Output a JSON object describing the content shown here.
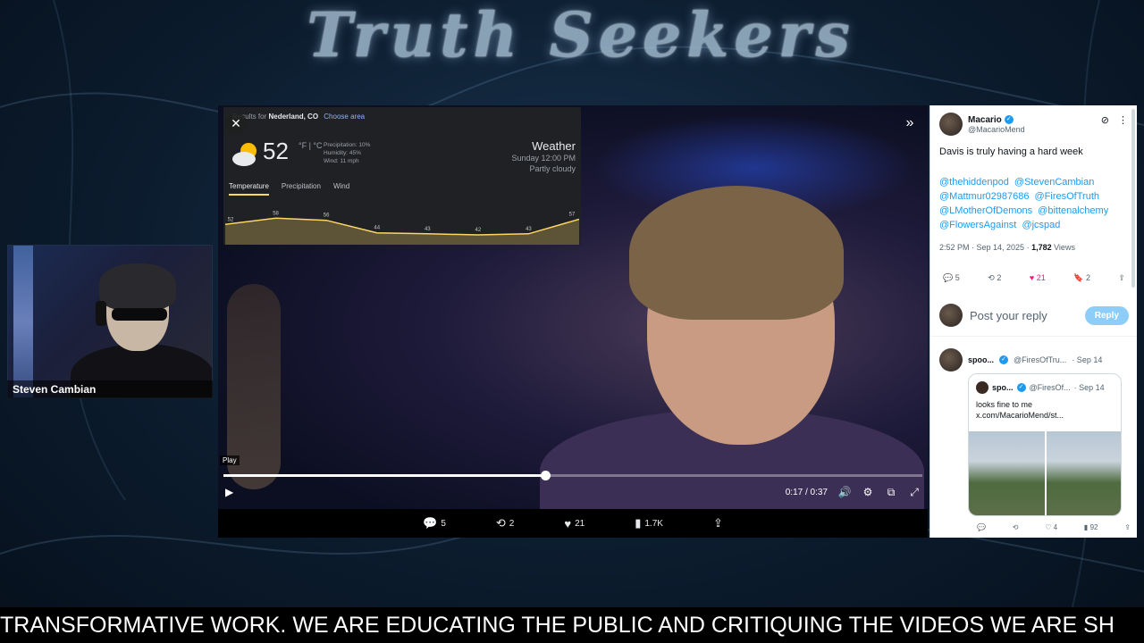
{
  "brand": {
    "title": "Truth Seekers"
  },
  "webcam": {
    "name": "Steven Cambian"
  },
  "weather": {
    "results_prefix": "Results for",
    "location": "Nederland, CO",
    "choose_area": "Choose area",
    "temp": "52",
    "units": "°F | °C",
    "precipitation": "Precipitation: 10%",
    "humidity": "Humidity: 45%",
    "wind": "Wind: 11 mph",
    "title": "Weather",
    "time": "Sunday 12:00 PM",
    "condition": "Partly cloudy",
    "tabs": [
      "Temperature",
      "Precipitation",
      "Wind"
    ],
    "graph_values": [
      52,
      58,
      56,
      44,
      43,
      42,
      43,
      57
    ]
  },
  "player": {
    "play_tooltip": "Play",
    "time": "0:17 / 0:37",
    "progress_fraction": 0.46
  },
  "video_actions": {
    "replies": "5",
    "reposts": "2",
    "likes": "21",
    "views": "1.7K"
  },
  "tweet": {
    "name": "Macario",
    "handle": "@MacarioMend",
    "text": "Davis is truly having a hard week",
    "mentions": [
      "@thehiddenpod",
      "@StevenCambian",
      "@Mattmur02987686",
      "@FiresOfTruth",
      "@LMotherOfDemons",
      "@bittenalchemy",
      "@FlowersAgainst",
      "@jcspad"
    ],
    "time": "2:52 PM · Sep 14, 2025 · ",
    "views_count": "1,782",
    "views_label": " Views",
    "replies": "5",
    "reposts": "2",
    "likes": "21",
    "bookmarks": "2",
    "reply_placeholder": "Post your reply",
    "reply_button": "Reply"
  },
  "reply": {
    "name": "spoo...",
    "handle": "@FiresOfTru...",
    "date": "· Sep 14",
    "quote": {
      "name": "spo...",
      "handle": "@FiresOf...",
      "date": "· Sep 14",
      "text1": "looks fine to me",
      "text2": "x.com/MacarioMend/st..."
    },
    "replies": "",
    "reposts": "",
    "likes": "4",
    "views": "92"
  },
  "ticker": {
    "text": "TRANSFORMATIVE WORK. WE ARE EDUCATING THE PUBLIC AND CRITIQUING THE VIDEOS WE ARE SH"
  },
  "colors": {
    "accent": "#1d9bf0",
    "like": "#f91880",
    "ticker_bg": "#000000"
  }
}
